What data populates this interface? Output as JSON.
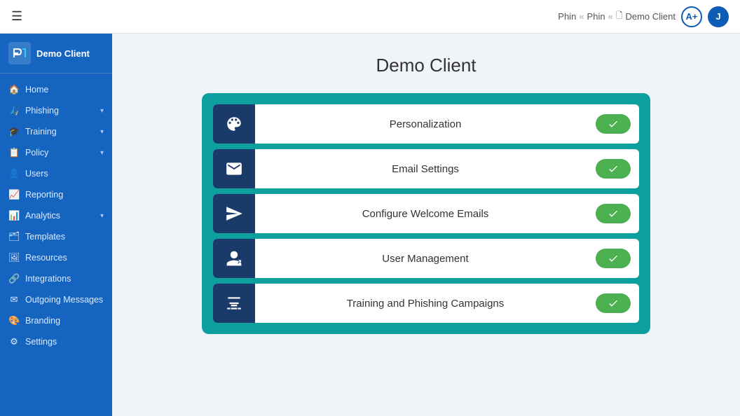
{
  "topbar": {
    "menu_icon": "☰",
    "breadcrumb": {
      "item1": "Phin",
      "sep1": "«",
      "item2": "Phin",
      "sep2": "«",
      "item3": "Demo Client"
    },
    "avatar_a_label": "A+",
    "avatar_j_label": "J"
  },
  "sidebar": {
    "logo_text": "Demo Client",
    "items": [
      {
        "id": "home",
        "label": "Home",
        "icon": "home",
        "has_chevron": false
      },
      {
        "id": "phishing",
        "label": "Phishing",
        "icon": "phishing",
        "has_chevron": true
      },
      {
        "id": "training",
        "label": "Training",
        "icon": "training",
        "has_chevron": true
      },
      {
        "id": "policy",
        "label": "Policy",
        "icon": "policy",
        "has_chevron": true
      },
      {
        "id": "users",
        "label": "Users",
        "icon": "users",
        "has_chevron": false
      },
      {
        "id": "reporting",
        "label": "Reporting",
        "icon": "reporting",
        "has_chevron": false
      },
      {
        "id": "analytics",
        "label": "Analytics",
        "icon": "analytics",
        "has_chevron": true
      },
      {
        "id": "templates",
        "label": "Templates",
        "icon": "templates",
        "has_chevron": false
      },
      {
        "id": "resources",
        "label": "Resources",
        "icon": "resources",
        "has_chevron": false
      },
      {
        "id": "integrations",
        "label": "Integrations",
        "icon": "integrations",
        "has_chevron": false
      },
      {
        "id": "outgoing-messages",
        "label": "Outgoing Messages",
        "icon": "outgoing",
        "has_chevron": false
      },
      {
        "id": "branding",
        "label": "Branding",
        "icon": "branding",
        "has_chevron": false
      },
      {
        "id": "settings",
        "label": "Settings",
        "icon": "settings",
        "has_chevron": false
      }
    ]
  },
  "main": {
    "title": "Demo Client",
    "rows": [
      {
        "id": "personalization",
        "label": "Personalization",
        "icon": "palette",
        "checked": true
      },
      {
        "id": "email-settings",
        "label": "Email Settings",
        "icon": "email",
        "checked": true
      },
      {
        "id": "configure-welcome-emails",
        "label": "Configure Welcome Emails",
        "icon": "send",
        "checked": true
      },
      {
        "id": "user-management",
        "label": "User Management",
        "icon": "user-cog",
        "checked": true
      },
      {
        "id": "training-phishing",
        "label": "Training and Phishing Campaigns",
        "icon": "megaphone",
        "checked": true
      }
    ]
  }
}
